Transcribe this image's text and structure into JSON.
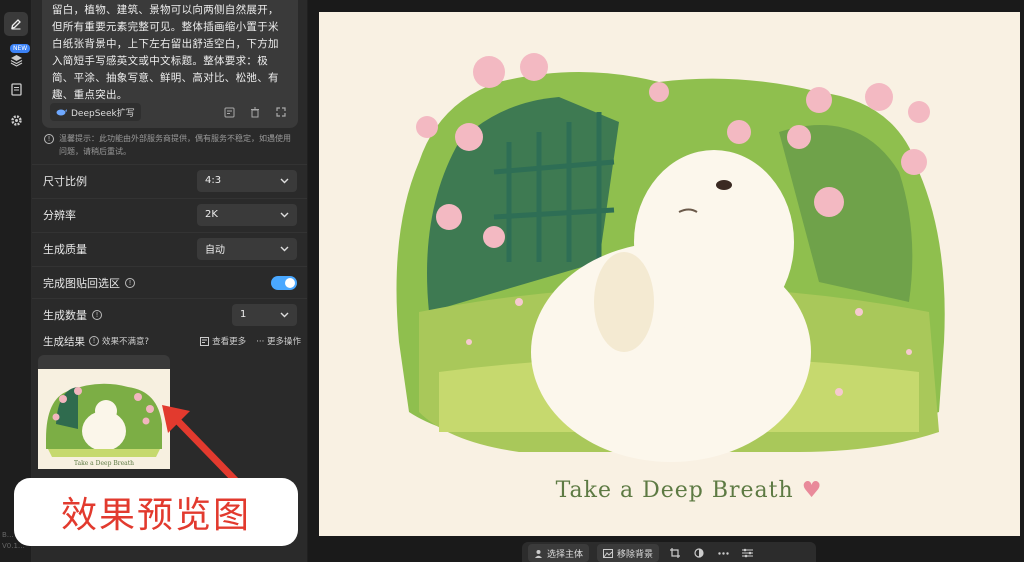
{
  "rail": {
    "new_badge": "NEW",
    "version": "B…\nV0.1…"
  },
  "prompt": {
    "text": "留白，植物、建筑、景物可以向两侧自然展开，但所有重要元素完整可见。整体插画缩小置于米白纸张背景中，上下左右留出舒适空白，下方加入简短手写感英文或中文标题。整体要求：极简、平涂、抽象写意、鲜明、高对比、松弛、有趣、重点突出。",
    "deepseek_label": "DeepSeek扩写"
  },
  "notice": "温馨提示：此功能由外部服务商提供，偶有服务不稳定，如遇使用问题，请稍后重试。",
  "settings": {
    "aspect_label": "尺寸比例",
    "aspect_value": "4:3",
    "resolution_label": "分辨率",
    "resolution_value": "2K",
    "quality_label": "生成质量",
    "quality_value": "自动",
    "paste_back_label": "完成图贴回选区",
    "count_label": "生成数量",
    "count_value": "1"
  },
  "results": {
    "title": "生成结果",
    "unsatisfied": "效果不满意?",
    "view_more": "查看更多",
    "more_actions": "··· 更多操作",
    "thumb_caption": "Take a Deep Breath"
  },
  "overlay_label": "效果预览图",
  "artwork": {
    "caption": "Take a Deep Breath",
    "heart": "♥"
  },
  "bottom_bar": {
    "select_subject": "选择主体",
    "remove_bg": "移除背景"
  },
  "colors": {
    "accent": "#4aa8ff",
    "arrow": "#e23a2e",
    "paper": "#f9f1e3",
    "caption_green": "#5d7a43"
  }
}
